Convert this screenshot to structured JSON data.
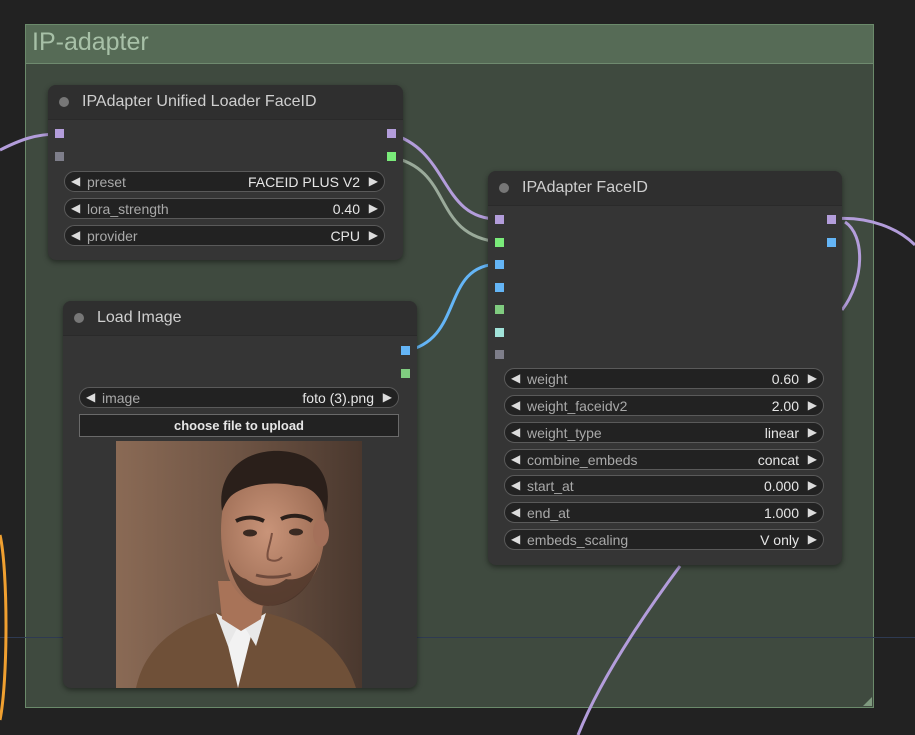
{
  "group": {
    "title": "IP-adapter"
  },
  "loader_node": {
    "title": "IPAdapter Unified Loader FaceID",
    "widgets": [
      {
        "label": "preset",
        "value": "FACEID PLUS V2"
      },
      {
        "label": "lora_strength",
        "value": "0.40"
      },
      {
        "label": "provider",
        "value": "CPU"
      }
    ]
  },
  "load_image_node": {
    "title": "Load Image",
    "image_widget": {
      "label": "image",
      "value": "foto (3).png"
    },
    "upload_label": "choose file to upload"
  },
  "faceid_node": {
    "title": "IPAdapter FaceID",
    "widgets": [
      {
        "label": "weight",
        "value": "0.60"
      },
      {
        "label": "weight_faceidv2",
        "value": "2.00"
      },
      {
        "label": "weight_type",
        "value": "linear"
      },
      {
        "label": "combine_embeds",
        "value": "concat"
      },
      {
        "label": "start_at",
        "value": "0.000"
      },
      {
        "label": "end_at",
        "value": "1.000"
      },
      {
        "label": "embeds_scaling",
        "value": "V only"
      }
    ]
  },
  "arrows": {
    "left": "◀",
    "right": "▶"
  },
  "icons": {
    "left-arrow": "arrow-left-icon",
    "right-arrow": "arrow-right-icon",
    "status-dot": "status-dot-icon"
  },
  "colors": {
    "model_slot": "#b39ddb",
    "ipadapter_slot": "#7aeb7a",
    "image_slot": "#64b5f6",
    "clip_vision_slot": "#a1e3d9",
    "mask_slot": "#80cc80",
    "insightface_slot": "#7e7e8a",
    "group_bg": "#3f4a3f",
    "group_header": "#566b56"
  }
}
